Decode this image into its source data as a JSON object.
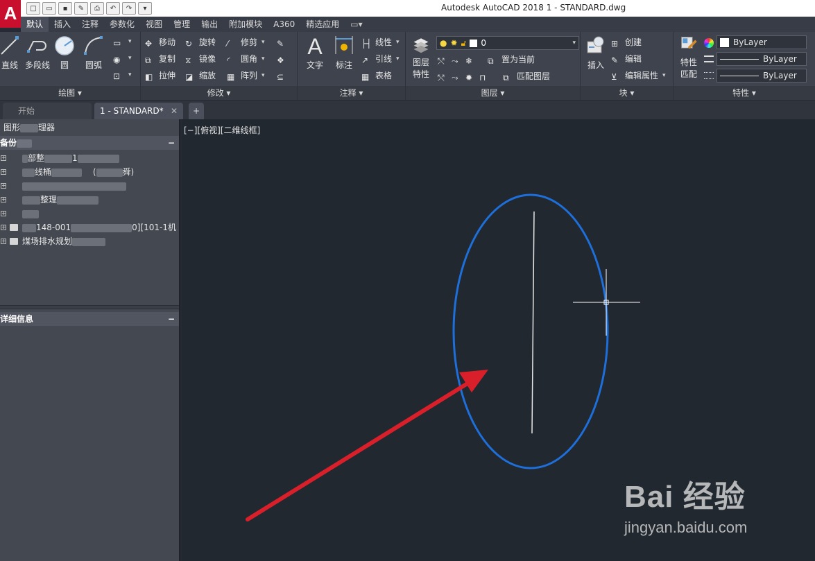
{
  "window": {
    "title": "Autodesk AutoCAD 2018    1 - STANDARD.dwg",
    "logo": "A"
  },
  "ribbon_tabs": [
    "默认",
    "插入",
    "注释",
    "参数化",
    "视图",
    "管理",
    "输出",
    "附加模块",
    "A360",
    "精选应用"
  ],
  "ribbon": {
    "draw": {
      "title": "绘图",
      "line": "直线",
      "polyline": "多段线",
      "circle": "圆",
      "arc": "圆弧"
    },
    "modify": {
      "title": "修改",
      "move": "移动",
      "rotate": "旋转",
      "trim": "修剪",
      "copy": "复制",
      "mirror": "镜像",
      "fillet": "圆角",
      "stretch": "拉伸",
      "scale": "缩放",
      "array": "阵列"
    },
    "annotation": {
      "title": "注释",
      "text": "文字",
      "dimension": "标注",
      "linear": "线性",
      "leader": "引线",
      "table": "表格"
    },
    "layers": {
      "title": "图层",
      "layer_properties_1": "图层",
      "layer_properties_2": "特性",
      "current_layer": "0",
      "make_current": "置为当前",
      "match_layer": "匹配图层"
    },
    "block": {
      "title": "块",
      "insert": "插入",
      "create": "创建",
      "edit": "编辑",
      "edit_attributes": "编辑属性"
    },
    "properties": {
      "title": "特性",
      "match_1": "特性",
      "match_2": "匹配",
      "color": "ByLayer",
      "linetype": "ByLayer",
      "lineweight": "ByLayer"
    }
  },
  "doc_tabs": {
    "start": "开始",
    "current": "1 - STANDARD*",
    "add": "+"
  },
  "palette": {
    "title": "图形",
    "title_suffix": "理器",
    "section_top": "备份",
    "collapse": "−",
    "tree": [
      {
        "pre": "",
        "mid": "部整",
        "post": "1"
      },
      {
        "pre": "",
        "mid": "线桶",
        "post": "(",
        "end": "舜)"
      },
      {
        "pre": "",
        "mid": "",
        "post": ""
      },
      {
        "pre": "",
        "mid": "整理",
        "post": ""
      },
      {
        "pre": "",
        "mid": "",
        "post": ""
      },
      {
        "pre": "",
        "mid": "148-001",
        "post": "0][101-1机"
      },
      {
        "pre": "",
        "mid": "煤场排水规划",
        "post": ""
      }
    ],
    "section_details": "详细信息"
  },
  "viewport": {
    "label": "[−][俯视][二维线框]"
  },
  "watermark": {
    "brand": "Bai 经验",
    "url": "jingyan.baidu.com"
  },
  "annotation_colors": {
    "highlight_ellipse": "#1e6fd9",
    "arrow": "#d9202a"
  }
}
